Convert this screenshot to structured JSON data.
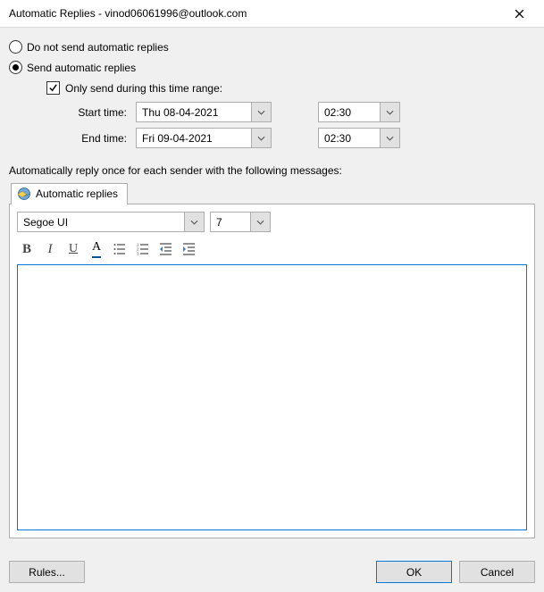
{
  "title": "Automatic Replies - vinod06061996@outlook.com",
  "options": {
    "do_not_send": "Do not send automatic replies",
    "send": "Send automatic replies",
    "only_send_range": "Only send during this time range:"
  },
  "datetime": {
    "start_label": "Start time:",
    "end_label": "End time:",
    "start_date": "Thu 08-04-2021",
    "start_time": "02:30",
    "end_date": "Fri 09-04-2021",
    "end_time": "02:30"
  },
  "instruction": "Automatically reply once for each sender with the following messages:",
  "tab_label": "Automatic replies",
  "format": {
    "font": "Segoe UI",
    "size": "7"
  },
  "buttons": {
    "rules": "Rules...",
    "ok": "OK",
    "cancel": "Cancel"
  }
}
